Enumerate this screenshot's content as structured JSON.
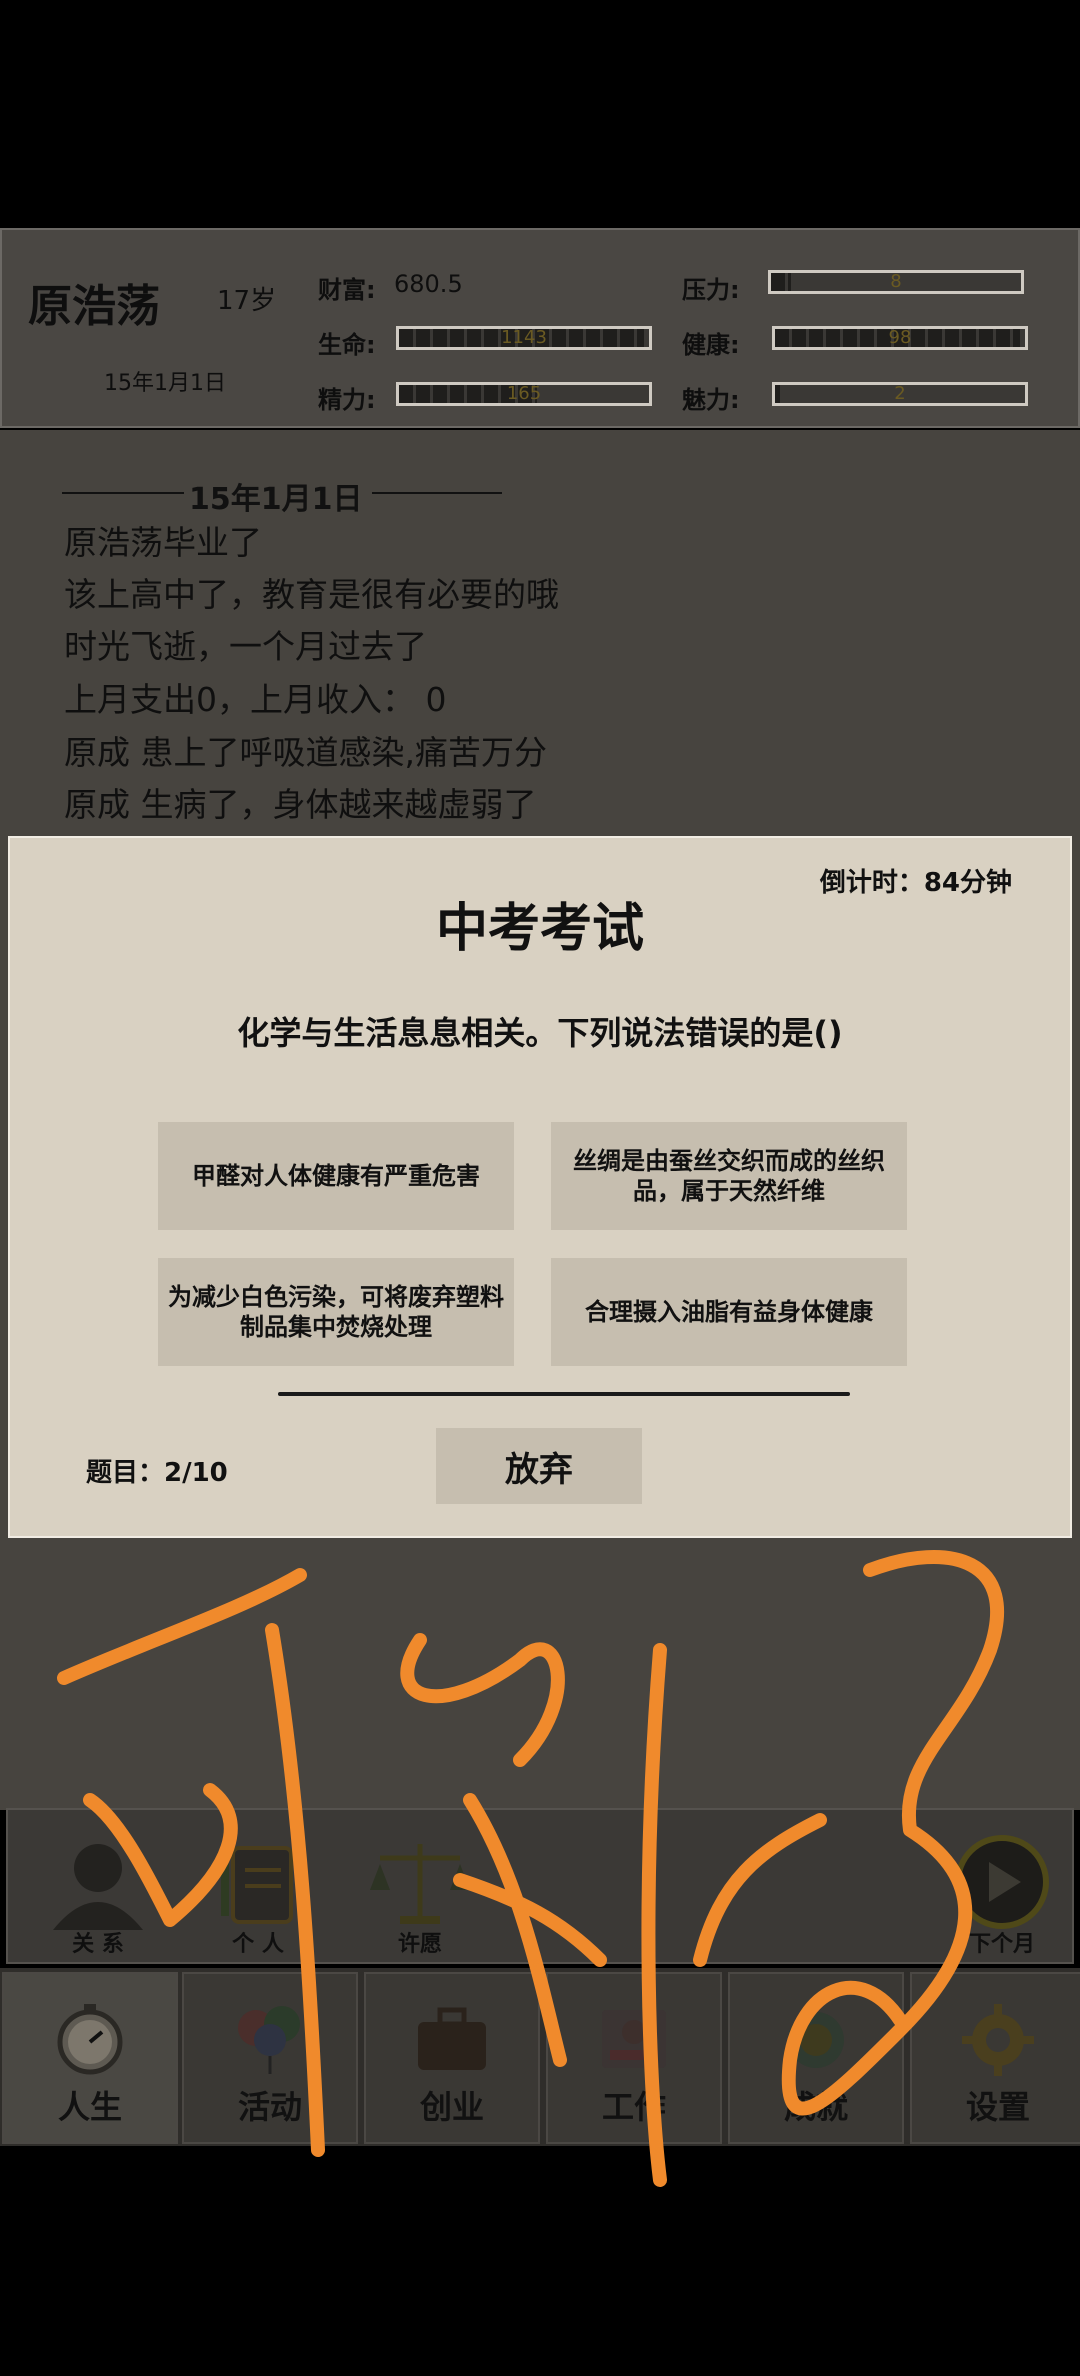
{
  "player": {
    "name": "原浩荡",
    "age": "17岁",
    "date": "15年1月1日"
  },
  "stats": {
    "wealth_label": "财富:",
    "wealth_value": "680.5",
    "life_label": "生命:",
    "life_value": "1143",
    "life_level": 0.98,
    "energy_label": "精力:",
    "energy_value": "165",
    "energy_level": 0.55,
    "stress_label": "压力:",
    "stress_value": "8",
    "stress_level": 0.08,
    "health_label": "健康:",
    "health_value": "98",
    "health_level": 0.98,
    "charm_label": "魅力:",
    "charm_value": "2",
    "charm_level": 0.02
  },
  "log": {
    "header": "15年1月1日",
    "lines": [
      "原浩荡毕业了",
      "该上高中了，教育是很有必要的哦",
      "时光飞逝，一个月过去了",
      "上月支出0，上月收入： 0",
      "原成 患上了呼吸道感染,痛苦万分",
      "原成 生病了，身体越来越虚弱了"
    ]
  },
  "exam": {
    "countdown": "倒计时：84分钟",
    "title": "中考考试",
    "question": "化学与生活息息相关。下列说法错误的是()",
    "options": [
      "甲醛对人体健康有严重危害",
      "丝绸是由蚕丝交织而成的丝织品，属于天然纤维",
      "为减少白色污染，可将废弃塑料制品集中焚烧处理",
      "合理摄入油脂有益身体健康"
    ],
    "counter": "题目：2/10",
    "give_up": "放弃"
  },
  "subbar": {
    "relations": "关 系",
    "personal": "个 人",
    "wish": "许愿",
    "next_month": "下个月"
  },
  "nav": [
    "人生",
    "活动",
    "创业",
    "工作",
    "成就",
    "设置"
  ],
  "colors": {
    "scribble": "#f08a2c",
    "panel": "#d9d1c2",
    "background": "#47443f"
  }
}
